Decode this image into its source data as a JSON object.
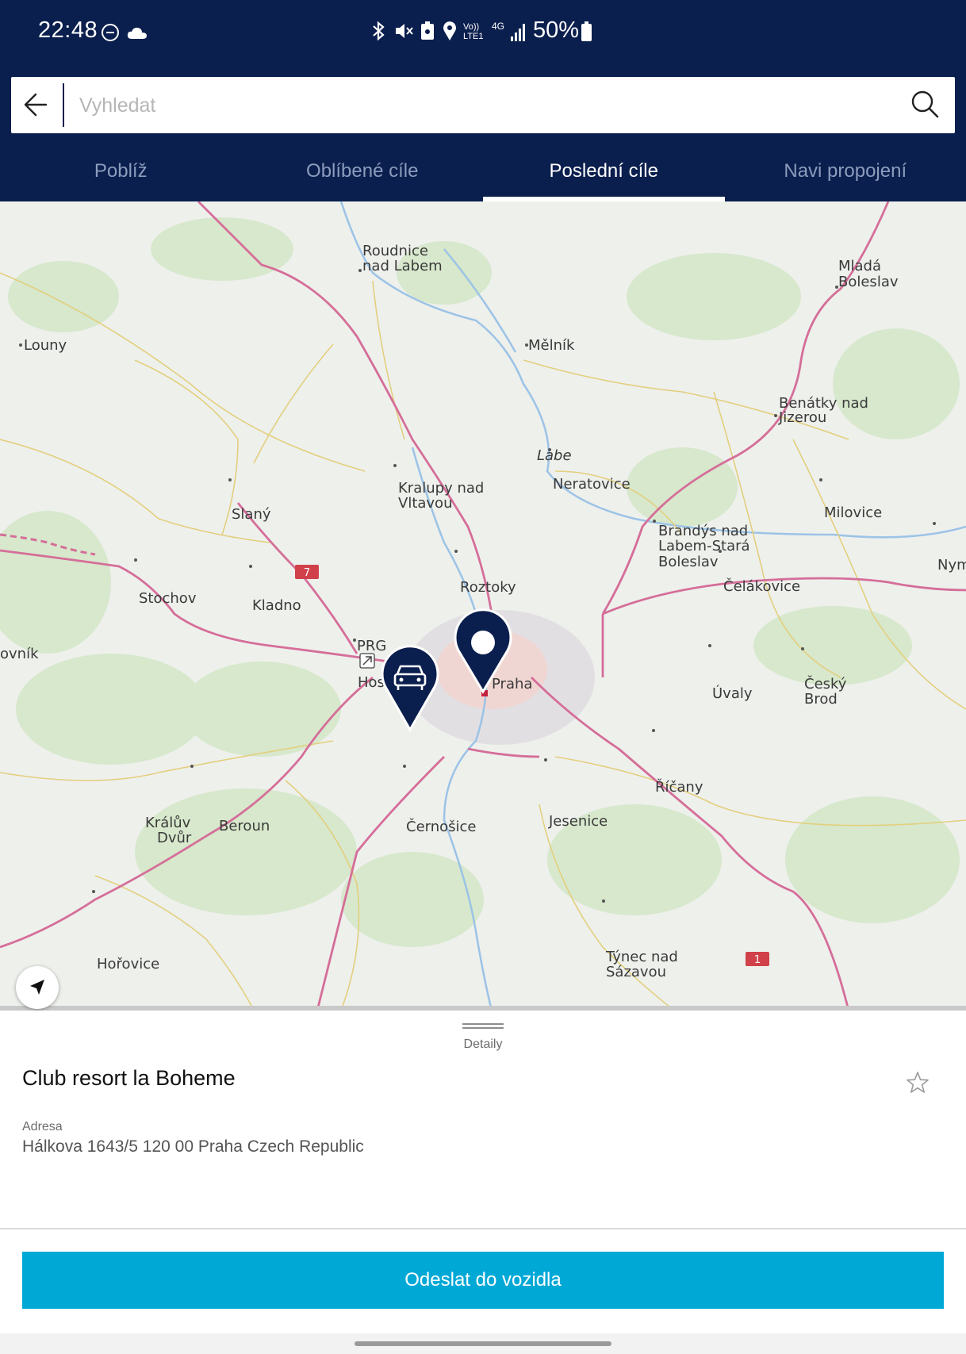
{
  "status_bar": {
    "time": "22:48",
    "battery": "50%",
    "network_type": "4G",
    "volte_label": "Vo)) LTE1",
    "icons": [
      "do-not-disturb-icon",
      "cloud-icon",
      "bluetooth-icon",
      "mute-icon",
      "nfc-icon",
      "location-icon",
      "signal-icon",
      "battery-icon"
    ]
  },
  "search": {
    "placeholder": "Vyhledat",
    "value": ""
  },
  "tabs": [
    {
      "label": "Poblíž",
      "active": false
    },
    {
      "label": "Oblíbené cíle",
      "active": false
    },
    {
      "label": "Poslední cíle",
      "active": true
    },
    {
      "label": "Navi propojení",
      "active": false
    }
  ],
  "map": {
    "labels": {
      "roudnice_1": "Roudnice",
      "roudnice_2": "nad Labem",
      "mlada_1": "Mladá",
      "mlada_2": "Boleslav",
      "louny": "Louny",
      "melnik": "Mělník",
      "benatky_1": "Benátky nad",
      "benatky_2": "Jizerou",
      "labe": "Labe",
      "kralupy_1": "Kralupy nad",
      "kralupy_2": "Vltavou",
      "neratovice": "Neratovice",
      "slany": "Slaný",
      "milovice": "Milovice",
      "brandys_1": "Brandýs nad",
      "brandys_2": "Labem-Stará",
      "brandys_3": "Boleslav",
      "nym": "Nym",
      "roztoky": "Roztoky",
      "celakovice": "Čelákovice",
      "stochov": "Stochov",
      "kladno": "Kladno",
      "ovnik": "ovník",
      "prg": "PRG",
      "praha": "Praha",
      "hos": "Hos",
      "uvaly": "Úvaly",
      "cesky_1": "Český",
      "cesky_2": "Brod",
      "ricany": "Říčany",
      "kraluv_1": "Králův",
      "kraluv_2": "Dvůr",
      "beroun": "Beroun",
      "cernosice": "Černošice",
      "jesenice": "Jesenice",
      "horovice": "Hořovice",
      "tynec_1": "Týnec nad",
      "tynec_2": "Sázavou",
      "road_7": "7",
      "road_1": "1"
    },
    "markers": [
      "vehicle-location-marker",
      "destination-marker"
    ]
  },
  "detail": {
    "handle_label": "Detaily",
    "place_name": "Club resort la Boheme",
    "address_label": "Adresa",
    "address": "Hálkova 1643/5 120 00 Praha Czech Republic",
    "send_button": "Odeslat do vozidla"
  },
  "colors": {
    "header_bg": "#0b1f4e",
    "accent": "#00a8d6",
    "marker": "#0b1f4e"
  }
}
